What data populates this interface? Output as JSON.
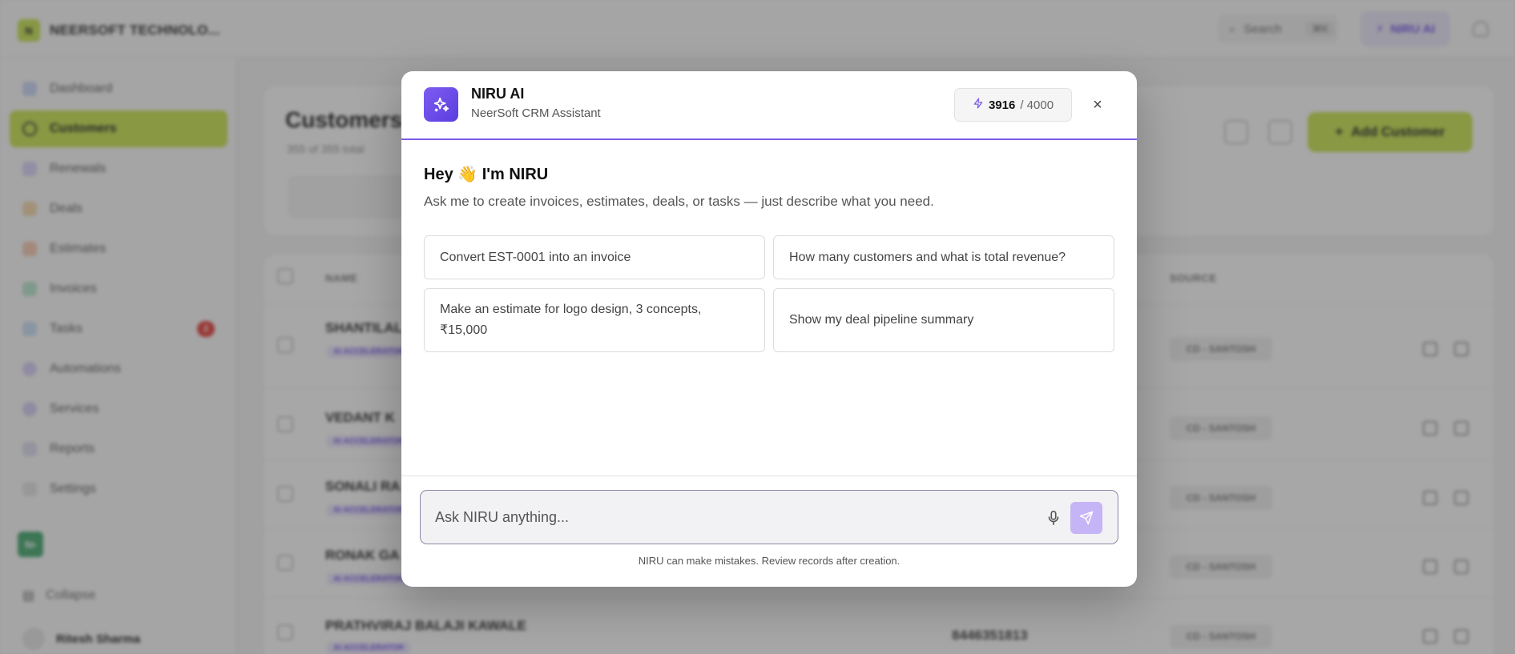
{
  "app": {
    "brand_name": "NEERSOFT TECHNOLO...",
    "brand_initial": "N",
    "search_label": "Search",
    "search_shortcut": "⌘K",
    "niru_button": "NIRU AI",
    "sidebar": [
      {
        "label": "Dashboard"
      },
      {
        "label": "Customers",
        "active": true
      },
      {
        "label": "Renewals"
      },
      {
        "label": "Deals"
      },
      {
        "label": "Estimates"
      },
      {
        "label": "Invoices"
      },
      {
        "label": "Tasks",
        "badge": "2"
      },
      {
        "label": "Automations"
      },
      {
        "label": "Services"
      },
      {
        "label": "Reports"
      },
      {
        "label": "Settings"
      }
    ],
    "org_initials": "N•",
    "collapse_label": "Collapse",
    "user_name": "Ritesh Sharma",
    "page_title": "Customers",
    "page_subtitle": "355 of 355 total",
    "add_customer": "Add Customer",
    "columns": {
      "name": "NAME",
      "source": "SOURCE"
    },
    "rows": [
      {
        "name": "SHANTILAL",
        "tag": "AI ACCELERATOR",
        "source": "CD - SANTOSH"
      },
      {
        "name": "VEDANT K",
        "tag": "AI ACCELERATOR",
        "source": "CD - SANTOSH"
      },
      {
        "name": "SONALI RA",
        "tag": "AI ACCELERATOR",
        "source": "CD - SANTOSH"
      },
      {
        "name": "RONAK GA",
        "tag": "AI ACCELERATOR",
        "source": "CD - SANTOSH"
      },
      {
        "name": "PRATHVIRAJ BALAJI KAWALE",
        "tag": "AI ACCELERATOR",
        "source": "CD - SANTOSH"
      }
    ],
    "last_phone": "8446351813"
  },
  "modal": {
    "title": "NIRU AI",
    "subtitle": "NeerSoft CRM Assistant",
    "credits_used": "3916",
    "credits_total": "/ 4000",
    "close_label": "×",
    "greeting": "Hey 👋 I'm NIRU",
    "description": "Ask me to create invoices, estimates, deals, or tasks — just describe what you need.",
    "suggestions": [
      "Convert EST-0001 into an invoice",
      "How many customers and what is total revenue?",
      "Make an estimate for logo design, 3 concepts, ₹15,000",
      "Show my deal pipeline summary"
    ],
    "input_placeholder": "Ask NIRU anything...",
    "disclaimer": "NIRU can make mistakes. Review records after creation."
  },
  "colors": {
    "accent_purple": "#6d4ee6",
    "brand_lime": "#c7e34a",
    "send_button": "#c5b4f6"
  }
}
